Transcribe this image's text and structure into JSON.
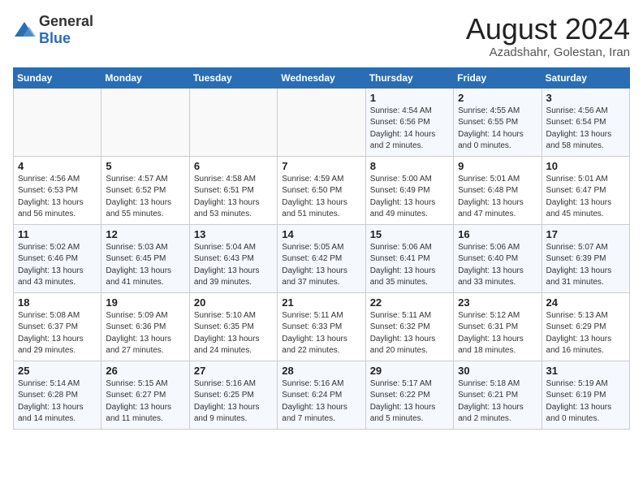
{
  "header": {
    "logo_general": "General",
    "logo_blue": "Blue",
    "month_year": "August 2024",
    "location": "Azadshahr, Golestan, Iran"
  },
  "weekdays": [
    "Sunday",
    "Monday",
    "Tuesday",
    "Wednesday",
    "Thursday",
    "Friday",
    "Saturday"
  ],
  "weeks": [
    [
      {
        "day": "",
        "info": ""
      },
      {
        "day": "",
        "info": ""
      },
      {
        "day": "",
        "info": ""
      },
      {
        "day": "",
        "info": ""
      },
      {
        "day": "1",
        "info": "Sunrise: 4:54 AM\nSunset: 6:56 PM\nDaylight: 14 hours\nand 2 minutes."
      },
      {
        "day": "2",
        "info": "Sunrise: 4:55 AM\nSunset: 6:55 PM\nDaylight: 14 hours\nand 0 minutes."
      },
      {
        "day": "3",
        "info": "Sunrise: 4:56 AM\nSunset: 6:54 PM\nDaylight: 13 hours\nand 58 minutes."
      }
    ],
    [
      {
        "day": "4",
        "info": "Sunrise: 4:56 AM\nSunset: 6:53 PM\nDaylight: 13 hours\nand 56 minutes."
      },
      {
        "day": "5",
        "info": "Sunrise: 4:57 AM\nSunset: 6:52 PM\nDaylight: 13 hours\nand 55 minutes."
      },
      {
        "day": "6",
        "info": "Sunrise: 4:58 AM\nSunset: 6:51 PM\nDaylight: 13 hours\nand 53 minutes."
      },
      {
        "day": "7",
        "info": "Sunrise: 4:59 AM\nSunset: 6:50 PM\nDaylight: 13 hours\nand 51 minutes."
      },
      {
        "day": "8",
        "info": "Sunrise: 5:00 AM\nSunset: 6:49 PM\nDaylight: 13 hours\nand 49 minutes."
      },
      {
        "day": "9",
        "info": "Sunrise: 5:01 AM\nSunset: 6:48 PM\nDaylight: 13 hours\nand 47 minutes."
      },
      {
        "day": "10",
        "info": "Sunrise: 5:01 AM\nSunset: 6:47 PM\nDaylight: 13 hours\nand 45 minutes."
      }
    ],
    [
      {
        "day": "11",
        "info": "Sunrise: 5:02 AM\nSunset: 6:46 PM\nDaylight: 13 hours\nand 43 minutes."
      },
      {
        "day": "12",
        "info": "Sunrise: 5:03 AM\nSunset: 6:45 PM\nDaylight: 13 hours\nand 41 minutes."
      },
      {
        "day": "13",
        "info": "Sunrise: 5:04 AM\nSunset: 6:43 PM\nDaylight: 13 hours\nand 39 minutes."
      },
      {
        "day": "14",
        "info": "Sunrise: 5:05 AM\nSunset: 6:42 PM\nDaylight: 13 hours\nand 37 minutes."
      },
      {
        "day": "15",
        "info": "Sunrise: 5:06 AM\nSunset: 6:41 PM\nDaylight: 13 hours\nand 35 minutes."
      },
      {
        "day": "16",
        "info": "Sunrise: 5:06 AM\nSunset: 6:40 PM\nDaylight: 13 hours\nand 33 minutes."
      },
      {
        "day": "17",
        "info": "Sunrise: 5:07 AM\nSunset: 6:39 PM\nDaylight: 13 hours\nand 31 minutes."
      }
    ],
    [
      {
        "day": "18",
        "info": "Sunrise: 5:08 AM\nSunset: 6:37 PM\nDaylight: 13 hours\nand 29 minutes."
      },
      {
        "day": "19",
        "info": "Sunrise: 5:09 AM\nSunset: 6:36 PM\nDaylight: 13 hours\nand 27 minutes."
      },
      {
        "day": "20",
        "info": "Sunrise: 5:10 AM\nSunset: 6:35 PM\nDaylight: 13 hours\nand 24 minutes."
      },
      {
        "day": "21",
        "info": "Sunrise: 5:11 AM\nSunset: 6:33 PM\nDaylight: 13 hours\nand 22 minutes."
      },
      {
        "day": "22",
        "info": "Sunrise: 5:11 AM\nSunset: 6:32 PM\nDaylight: 13 hours\nand 20 minutes."
      },
      {
        "day": "23",
        "info": "Sunrise: 5:12 AM\nSunset: 6:31 PM\nDaylight: 13 hours\nand 18 minutes."
      },
      {
        "day": "24",
        "info": "Sunrise: 5:13 AM\nSunset: 6:29 PM\nDaylight: 13 hours\nand 16 minutes."
      }
    ],
    [
      {
        "day": "25",
        "info": "Sunrise: 5:14 AM\nSunset: 6:28 PM\nDaylight: 13 hours\nand 14 minutes."
      },
      {
        "day": "26",
        "info": "Sunrise: 5:15 AM\nSunset: 6:27 PM\nDaylight: 13 hours\nand 11 minutes."
      },
      {
        "day": "27",
        "info": "Sunrise: 5:16 AM\nSunset: 6:25 PM\nDaylight: 13 hours\nand 9 minutes."
      },
      {
        "day": "28",
        "info": "Sunrise: 5:16 AM\nSunset: 6:24 PM\nDaylight: 13 hours\nand 7 minutes."
      },
      {
        "day": "29",
        "info": "Sunrise: 5:17 AM\nSunset: 6:22 PM\nDaylight: 13 hours\nand 5 minutes."
      },
      {
        "day": "30",
        "info": "Sunrise: 5:18 AM\nSunset: 6:21 PM\nDaylight: 13 hours\nand 2 minutes."
      },
      {
        "day": "31",
        "info": "Sunrise: 5:19 AM\nSunset: 6:19 PM\nDaylight: 13 hours\nand 0 minutes."
      }
    ]
  ]
}
